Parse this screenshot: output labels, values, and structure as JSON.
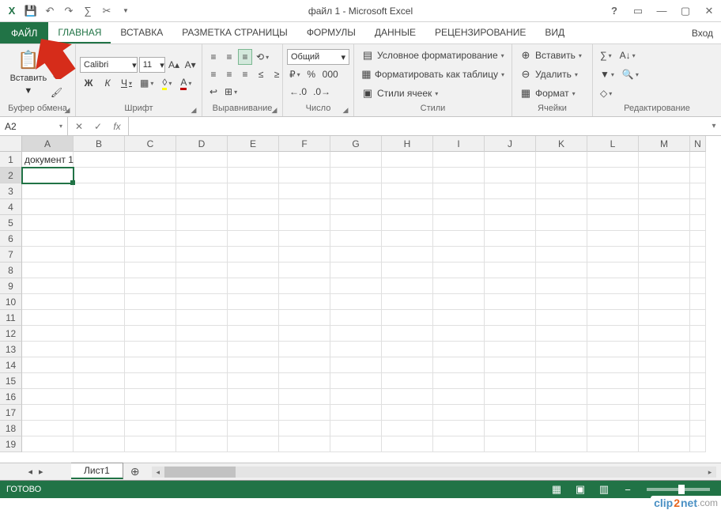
{
  "title": "файл 1 - Microsoft Excel",
  "qat": {
    "undo": "↶",
    "redo": "↷",
    "sum": "∑",
    "cut": "✂"
  },
  "tabs": {
    "file": "ФАЙЛ",
    "items": [
      "ГЛАВНАЯ",
      "ВСТАВКА",
      "РАЗМЕТКА СТРАНИЦЫ",
      "ФОРМУЛЫ",
      "ДАННЫЕ",
      "РЕЦЕНЗИРОВАНИЕ",
      "ВИД"
    ],
    "active": 0,
    "signin": "Вход"
  },
  "ribbon": {
    "clipboard": {
      "paste": "Вставить",
      "label": "Буфер обмена"
    },
    "font": {
      "name": "Calibri",
      "size": "11",
      "bold": "Ж",
      "italic": "К",
      "underline": "Ч",
      "label": "Шрифт"
    },
    "alignment": {
      "label": "Выравнивание"
    },
    "number": {
      "format": "Общий",
      "label": "Число"
    },
    "styles": {
      "condformat": "Условное форматирование",
      "formatTable": "Форматировать как таблицу",
      "cellStyles": "Стили ячеек",
      "label": "Стили"
    },
    "cells": {
      "insert": "Вставить",
      "delete": "Удалить",
      "format": "Формат",
      "label": "Ячейки"
    },
    "editing": {
      "label": "Редактирование"
    }
  },
  "namebox": "A2",
  "sheet": {
    "columns": [
      "A",
      "B",
      "C",
      "D",
      "E",
      "F",
      "G",
      "H",
      "I",
      "J",
      "K",
      "L",
      "M",
      "N"
    ],
    "rows": [
      1,
      2,
      3,
      4,
      5,
      6,
      7,
      8,
      9,
      10,
      11,
      12,
      13,
      14,
      15,
      16,
      17,
      18,
      19
    ],
    "activeCol": "A",
    "activeRow": 2,
    "cells": {
      "A1": "документ 1"
    },
    "tabname": "Лист1"
  },
  "status": "ГОТОВО",
  "watermark": {
    "brand1": "clip",
    "brand2": "2",
    "brand3": "net",
    "tld": ".com"
  }
}
